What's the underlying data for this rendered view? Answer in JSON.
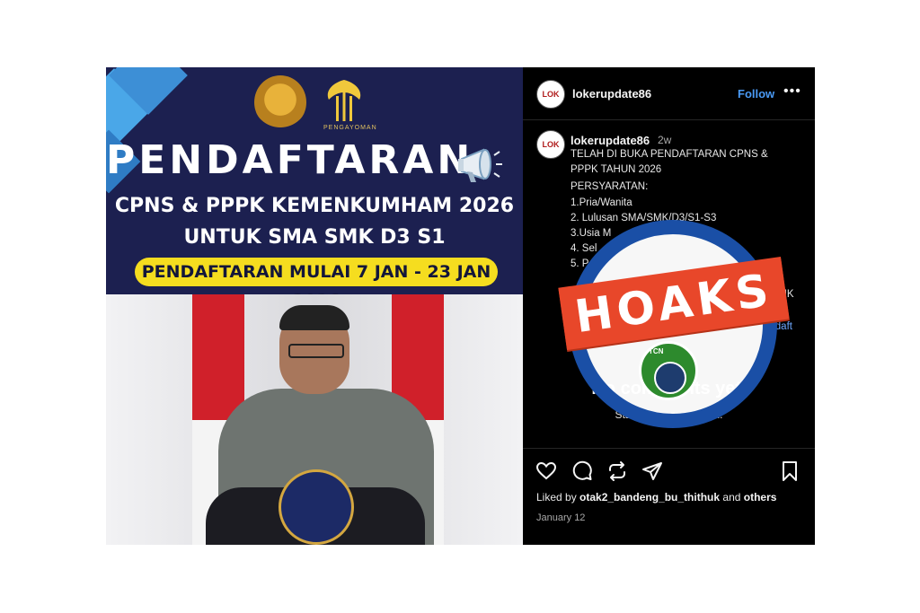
{
  "poster": {
    "logo1_caption": "",
    "logo2_caption": "PENGAYOMAN",
    "title": "PENDAFTARAN",
    "subtitle1": "CPNS & PPPK KEMENKUMHAM 2026",
    "subtitle2": "UNTUK SMA SMK D3 S1",
    "date_pill": "PENDAFTARAN MULAI 7 JAN - 23 JAN 2026",
    "colors": {
      "banner": "#1c2050",
      "pill": "#f5dd1f",
      "accent_shape": "#4aa7e8"
    }
  },
  "instagram": {
    "header": {
      "avatar_text": "LOK",
      "username": "lokerupdate86",
      "follow_label": "Follow",
      "more_label": "•••"
    },
    "caption": {
      "avatar_text": "LOK",
      "username": "lokerupdate86",
      "age": "2w",
      "lines": [
        "TELAH DI BUKA PENDAFTARAN CPNS &",
        "PPPK TAHUN 2026",
        "PERSYARATAN:",
        "1.Pria/Wanita",
        "2. Lulusan SMA/SMK/D3/S1-S3",
        "3.Usia M",
        "4. Sel",
        "5. P"
      ],
      "line9_tail": "g",
      "line10_tail": "LINK",
      "link_line_a": "endaft",
      "link_line_b": "ara"
    },
    "no_comments": "No comments yet.",
    "start_conversation": "Start the conversation.",
    "actions": [
      "heart-icon",
      "comment-icon",
      "repost-icon",
      "share-icon",
      "bookmark-icon"
    ],
    "liked_prefix": "Liked by ",
    "liked_user": "otak2_bandeng_bu_thithuk",
    "liked_suffix": " and ",
    "liked_others": "others",
    "date": "January 12",
    "colors": {
      "link": "#4a9af5",
      "background": "#000000"
    }
  },
  "stamp": {
    "label": "HOAKS",
    "badge_text": "TCN",
    "colors": {
      "ring": "#1a4fa6",
      "banner": "#e8472a",
      "badge": "#2d8a2d"
    }
  }
}
